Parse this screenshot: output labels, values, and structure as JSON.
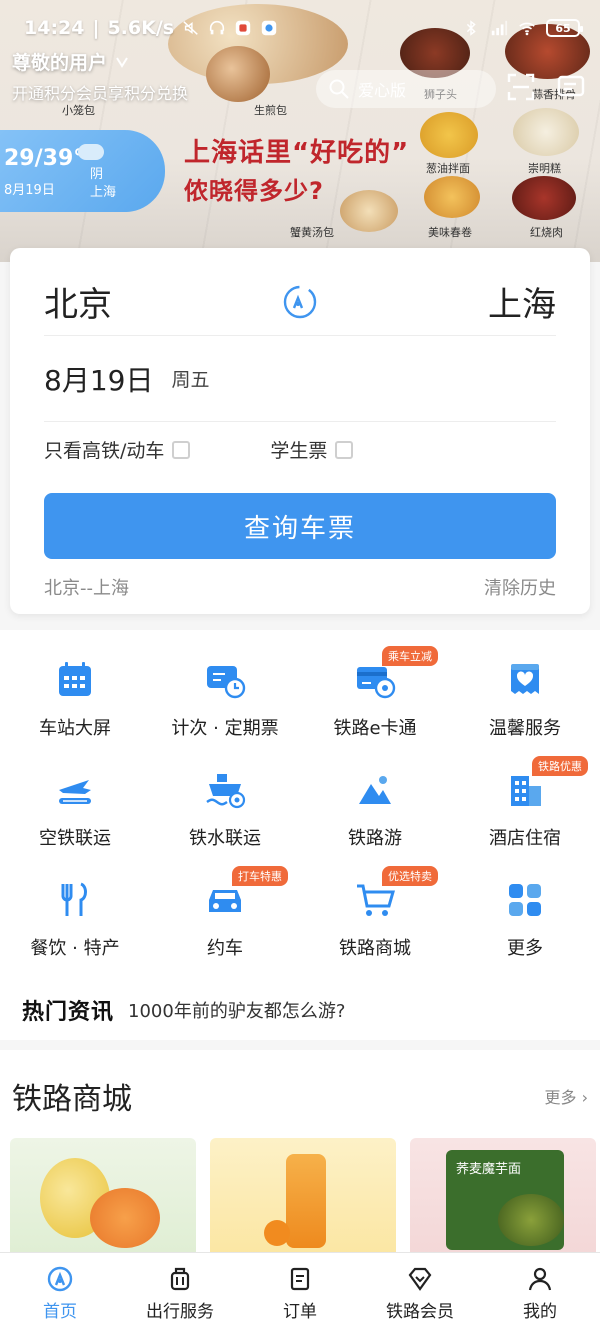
{
  "status_bar": {
    "time": "14:24",
    "speed": "5.6K/s",
    "battery": "65"
  },
  "hero": {
    "greeting": "尊敬的用户",
    "greeting_sub": "开通积分会员享积分兑换",
    "weather_temp": "29/39°",
    "weather_date": "8月19日",
    "weather_desc": "阴",
    "weather_city": "上海",
    "care_mode_label": "爱心版",
    "slogan_line1": "上海话里“好吃的”",
    "slogan_line2": "侬晓得多少?",
    "food_labels": [
      "小笼包",
      "生煎包",
      "狮子头",
      "蒜香排骨",
      "葱油拌面",
      "崇明糕",
      "蟹黄汤包",
      "美味春卷",
      "红烧肉"
    ]
  },
  "search": {
    "from_station": "北京",
    "to_station": "上海",
    "date": "8月19日",
    "weekday": "周五",
    "option_highspeed": "只看高铁/动车",
    "option_student": "学生票",
    "query_button": "查询车票",
    "history_item": "北京--上海",
    "clear_history": "清除历史"
  },
  "services": [
    {
      "label": "车站大屏",
      "icon": "station-screen-icon"
    },
    {
      "label": "计次 · 定期票",
      "icon": "ticket-pass-icon"
    },
    {
      "label": "铁路e卡通",
      "icon": "ecard-icon",
      "tag": "乘车立减"
    },
    {
      "label": "温馨服务",
      "icon": "care-service-icon"
    },
    {
      "label": "空铁联运",
      "icon": "air-rail-icon"
    },
    {
      "label": "铁水联运",
      "icon": "rail-water-icon"
    },
    {
      "label": "铁路游",
      "icon": "rail-travel-icon"
    },
    {
      "label": "酒店住宿",
      "icon": "hotel-icon",
      "tag": "铁路优惠"
    },
    {
      "label": "餐饮 · 特产",
      "icon": "dining-icon"
    },
    {
      "label": "约车",
      "icon": "car-icon",
      "tag": "打车特惠"
    },
    {
      "label": "铁路商城",
      "icon": "mall-cart-icon",
      "tag": "优选特卖"
    },
    {
      "label": "更多",
      "icon": "more-grid-icon"
    }
  ],
  "news": {
    "hot_label": "热门资讯",
    "headline": "1000年前的驴友都怎么游?"
  },
  "mall": {
    "title": "铁路商城",
    "more": "更多",
    "product_text": "荞麦魔芋面"
  },
  "tabbar": [
    {
      "label": "首页",
      "icon": "home-icon",
      "active": true
    },
    {
      "label": "出行服务",
      "icon": "luggage-icon",
      "active": false
    },
    {
      "label": "订单",
      "icon": "order-icon",
      "active": false
    },
    {
      "label": "铁路会员",
      "icon": "member-diamond-icon",
      "active": false
    },
    {
      "label": "我的",
      "icon": "profile-icon",
      "active": false
    }
  ],
  "colors": {
    "accent": "#3f95ef",
    "tag_orange": "#f06a3a",
    "hot_red": "#e23d2e"
  }
}
